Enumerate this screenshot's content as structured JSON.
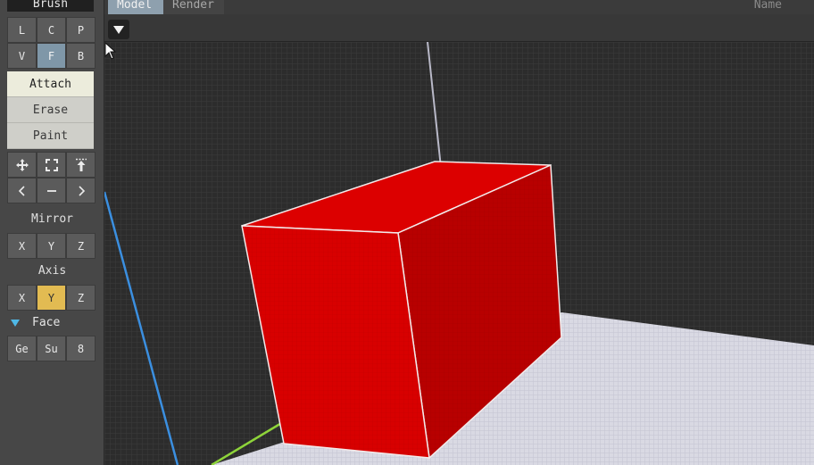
{
  "panel": {
    "title": "Brush",
    "row1": [
      "L",
      "C",
      "P"
    ],
    "row2": [
      "V",
      "F",
      "B"
    ],
    "modes": [
      "Attach",
      "Erase",
      "Paint"
    ],
    "selected_mode": "Attach",
    "transform_icons": [
      "move-icon",
      "select-frame-icon",
      "raise-icon"
    ],
    "nav_icons": [
      "chevron-left-icon",
      "minus-icon",
      "chevron-right-icon"
    ],
    "mirror": {
      "label": "Mirror",
      "buttons": [
        "X",
        "Y",
        "Z"
      ]
    },
    "axis": {
      "label": "Axis",
      "buttons": [
        "X",
        "Y",
        "Z"
      ],
      "selected": "Y"
    },
    "face": {
      "label": "Face",
      "buttons": [
        "Ge",
        "Su",
        "8"
      ]
    }
  },
  "tabs": {
    "model": "Model",
    "render": "Render",
    "name": "Name"
  },
  "colors": {
    "accent_blue": "#7f97a8",
    "axis_yellow": "#e2bb52",
    "cube_red": "#d40000",
    "floor": "#d8d8e2"
  }
}
